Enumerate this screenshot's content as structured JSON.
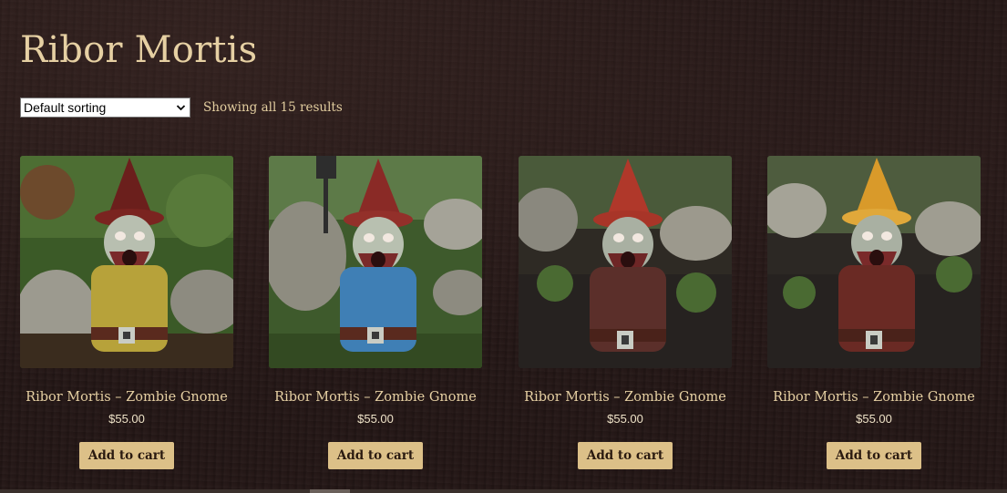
{
  "page": {
    "title": "Ribor Mortis"
  },
  "toolbar": {
    "sort_selected": "Default sorting",
    "result_count": "Showing all 15 results"
  },
  "products": [
    {
      "title": "Ribor Mortis – Zombie Gnome",
      "price": "$55.00",
      "button": "Add to cart",
      "shirt_color": "#b7a23a"
    },
    {
      "title": "Ribor Mortis – Zombie Gnome",
      "price": "$55.00",
      "button": "Add to cart",
      "shirt_color": "#3f7fb5"
    },
    {
      "title": "Ribor Mortis – Zombie Gnome",
      "price": "$55.00",
      "button": "Add to cart",
      "shirt_color": "#5b2f2a"
    },
    {
      "title": "Ribor Mortis – Zombie Gnome",
      "price": "$55.00",
      "button": "Add to cart",
      "shirt_color": "#6a2a24"
    }
  ],
  "colors": {
    "accent_button": "#dcc088",
    "title_text": "#e6d0a3",
    "background": "#241716"
  }
}
